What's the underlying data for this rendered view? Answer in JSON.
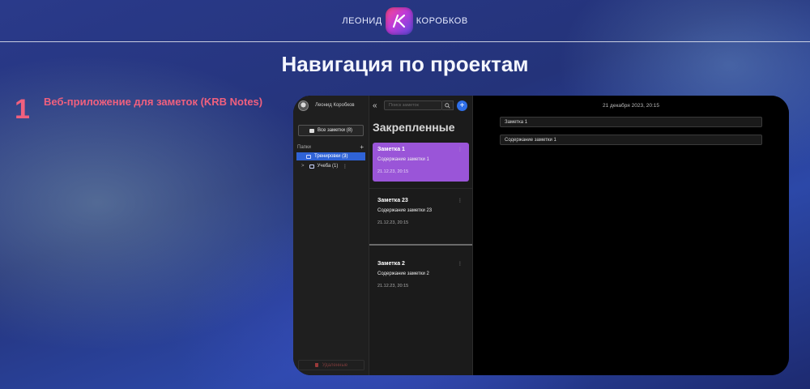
{
  "header": {
    "brand_first": "ЛЕОНИД",
    "brand_last": "КОРОБКОВ",
    "logo_icon": "lk-monogram-icon",
    "logo_gradient": [
      "#ff4a8a",
      "#c03ad8",
      "#5a4ae0"
    ]
  },
  "slide": {
    "title": "Навигация по проектам",
    "item_number": "1",
    "item_title": "Веб-приложение для заметок (KRB Notes)",
    "accent_color": "#f0607e"
  },
  "app": {
    "sidebar": {
      "user_name": "Леонид Коробков",
      "all_notes_label": "Все заметки (8)",
      "folders_label": "Папки",
      "add_folder_label": "+",
      "folders": [
        {
          "label": "Тренировки (3)",
          "active": true,
          "expand": ""
        },
        {
          "label": "Учеба (1)",
          "active": false,
          "expand": ">"
        }
      ],
      "folder_menu": "⋮",
      "trash_label": "Удаленные"
    },
    "list": {
      "collapse_label": "«",
      "search_placeholder": "Поиск заметок",
      "add_label": "+",
      "section_title": "Закрепленные",
      "notes": [
        {
          "title": "Заметка 1",
          "body": "Содержание заметки 1",
          "date": "21.12.23, 20:15",
          "menu": "⋮",
          "selected": true
        },
        {
          "title": "Заметка 23",
          "body": "Содержание заметки 23",
          "date": "21.12.23, 20:15",
          "menu": "⋮",
          "selected": false
        },
        {
          "title": "Заметка 2",
          "body": "Содержание заметки 2",
          "date": "21.12.23, 20:15",
          "menu": "⋮",
          "selected": false
        }
      ],
      "selected_color": "#9a55d8",
      "accent_blue": "#2f6fe8"
    },
    "editor": {
      "date": "21 декабря 2023, 20:15",
      "title_value": "Заметка 1",
      "body_value": "Содержание заметки 1"
    }
  }
}
